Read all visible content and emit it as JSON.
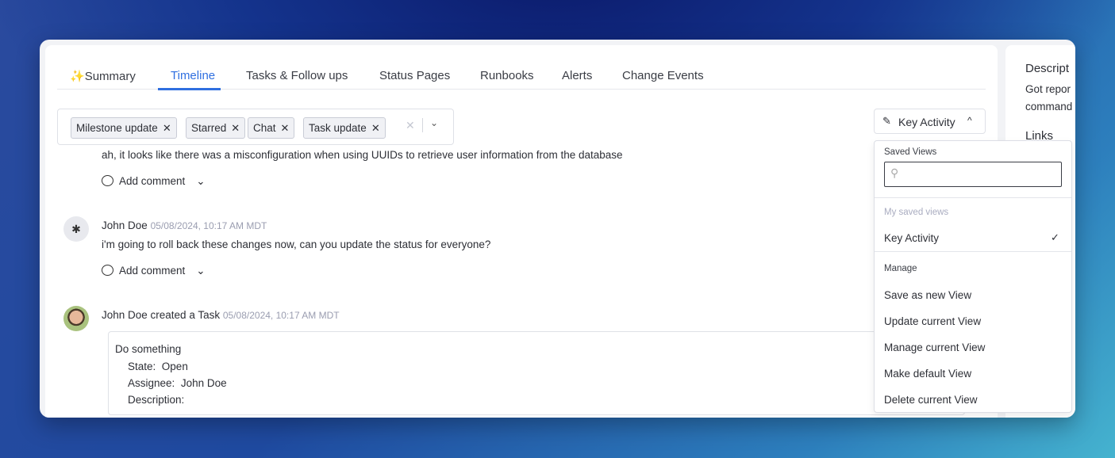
{
  "tabs": [
    {
      "label": "Summary",
      "icon": "sparkles-icon"
    },
    {
      "label": "Timeline",
      "active": true
    },
    {
      "label": "Tasks & Follow ups"
    },
    {
      "label": "Status Pages"
    },
    {
      "label": "Runbooks"
    },
    {
      "label": "Alerts"
    },
    {
      "label": "Change Events"
    }
  ],
  "filters": [
    "Milestone update",
    "Starred",
    "Chat",
    "Task update"
  ],
  "view_button": {
    "label": "Key Activity"
  },
  "timeline": [
    {
      "text": "ah, it looks like there was a misconfiguration when using UUIDs to retrieve user information from the database",
      "comment": "Add comment"
    },
    {
      "author": "John Doe",
      "time": "05/08/2024, 10:17 AM MDT",
      "text": "i'm going to roll back these changes now, can you update the status for everyone?",
      "comment": "Add comment"
    },
    {
      "author": "John Doe created a Task",
      "time": "05/08/2024, 10:17 AM MDT",
      "task": {
        "title": "Do something",
        "state_label": "State:",
        "state": "Open",
        "assignee_label": "Assignee:",
        "assignee": "John Doe",
        "description_label": "Description:"
      }
    }
  ],
  "menu": {
    "title": "Saved Views",
    "search_placeholder": "",
    "section_mine": "My saved views",
    "selected": "Key Activity",
    "section_manage": "Manage",
    "items": [
      "Save as new View",
      "Update current View",
      "Manage current View",
      "Make default View",
      "Delete current View"
    ]
  },
  "side": {
    "title": "Descript",
    "line1": "Got repor",
    "line2": "command",
    "links": "Links"
  },
  "colors": {
    "accent": "#2f6fe0"
  }
}
